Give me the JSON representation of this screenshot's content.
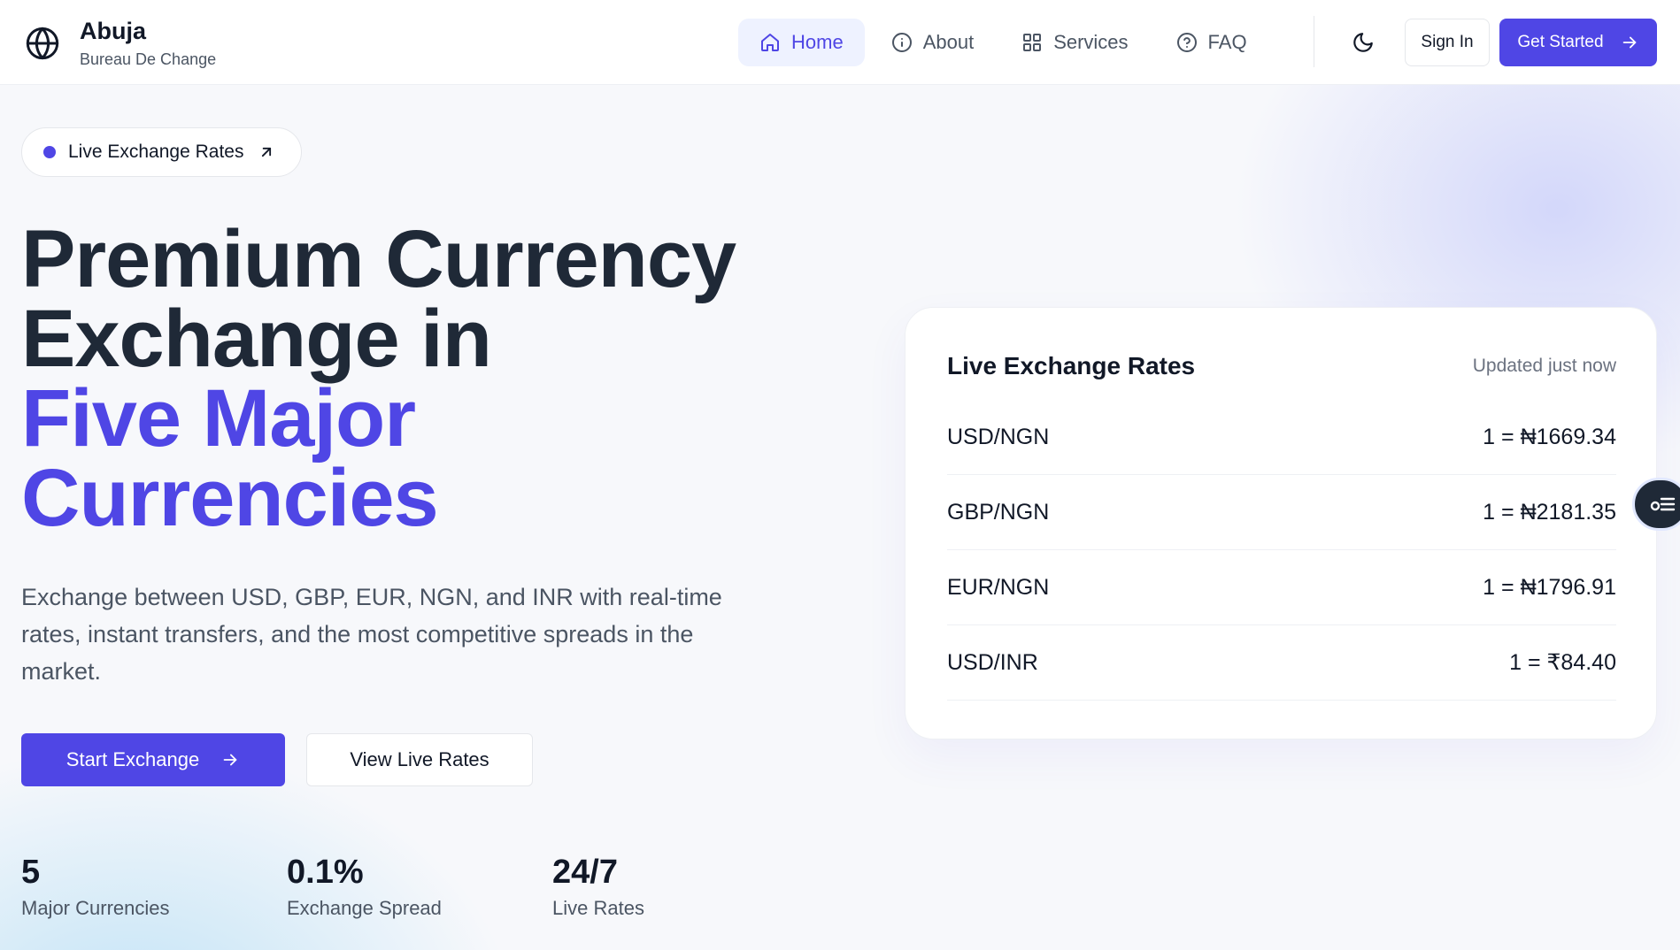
{
  "brand": {
    "title": "Abuja",
    "subtitle": "Bureau De Change"
  },
  "nav": [
    {
      "label": "Home",
      "icon": "home-icon",
      "active": true
    },
    {
      "label": "About",
      "icon": "info-icon"
    },
    {
      "label": "Services",
      "icon": "grid-icon"
    },
    {
      "label": "FAQ",
      "icon": "help-circle-icon"
    }
  ],
  "header_actions": {
    "signin": "Sign In",
    "get_started": "Get Started"
  },
  "hero": {
    "pill": "Live Exchange Rates",
    "title_line1": "Premium Currency",
    "title_line2": "Exchange in",
    "title_line3": "Five Major",
    "title_line4": "Currencies",
    "description": "Exchange between USD, GBP, EUR, NGN, and INR with real-time rates, instant transfers, and the most competitive spreads in the market.",
    "primary_cta": "Start Exchange",
    "secondary_cta": "View Live Rates"
  },
  "stats": [
    {
      "value": "5",
      "label": "Major Currencies"
    },
    {
      "value": "0.1%",
      "label": "Exchange Spread"
    },
    {
      "value": "24/7",
      "label": "Live Rates"
    }
  ],
  "rates": {
    "title": "Live Exchange Rates",
    "updated": "Updated just now",
    "rows": [
      {
        "pair": "USD/NGN",
        "value": "1 = ₦1669.34"
      },
      {
        "pair": "GBP/NGN",
        "value": "1 = ₦2181.35"
      },
      {
        "pair": "EUR/NGN",
        "value": "1 = ₦1796.91"
      },
      {
        "pair": "USD/INR",
        "value": "1 = ₹84.40"
      }
    ]
  },
  "colors": {
    "accent": "#4f46e5",
    "text": "#111827",
    "muted": "#4b5563"
  }
}
